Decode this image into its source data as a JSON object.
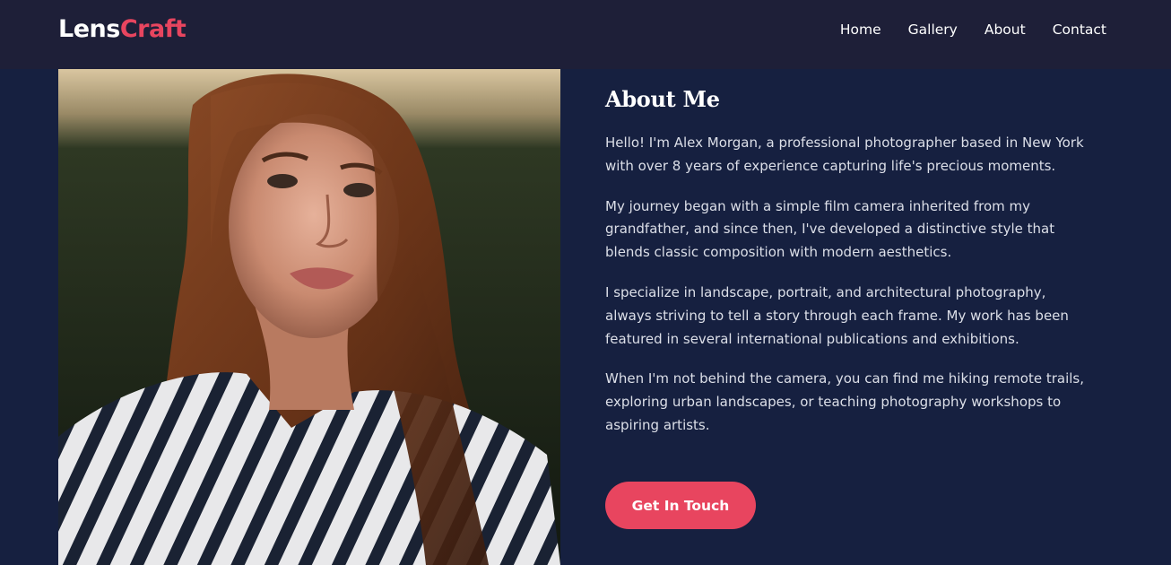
{
  "brand": {
    "name_part1": "Lens",
    "name_part2": "Craft"
  },
  "nav": [
    {
      "label": "Home"
    },
    {
      "label": "Gallery"
    },
    {
      "label": "About"
    },
    {
      "label": "Contact"
    }
  ],
  "about": {
    "title": "About Me",
    "paragraphs": [
      "Hello! I'm Alex Morgan, a professional photographer based in New York with over 8 years of experience capturing life's precious moments.",
      "My journey began with a simple film camera inherited from my grandfather, and since then, I've developed a distinctive style that blends classic composition with modern aesthetics.",
      "I specialize in landscape, portrait, and architectural photography, always striving to tell a story through each frame. My work has been featured in several international publications and exhibitions.",
      "When I'm not behind the camera, you can find me hiking remote trails, exploring urban landscapes, or teaching photography workshops to aspiring artists."
    ],
    "cta_label": "Get In Touch"
  },
  "colors": {
    "background": "#162040",
    "header": "#1e1f38",
    "accent": "#e8455f",
    "text": "#dcdfe8"
  }
}
